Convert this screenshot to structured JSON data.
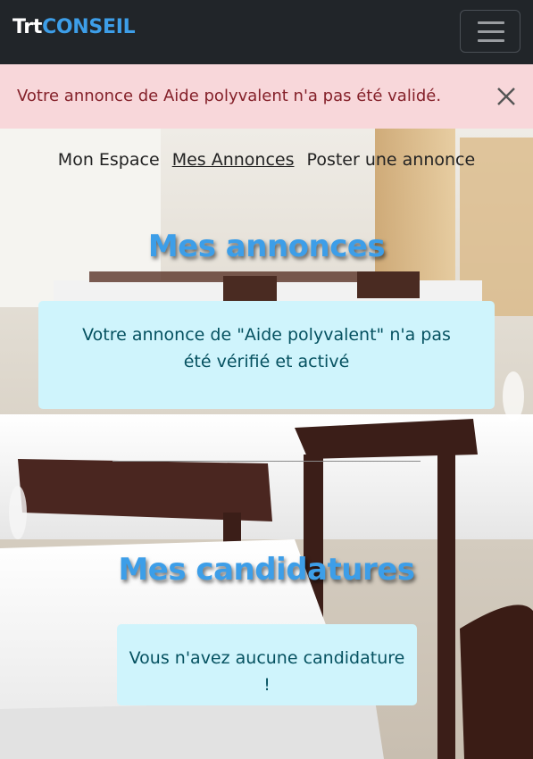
{
  "navbar": {
    "brand_part1": "Trt",
    "brand_part2": "CONSEIL",
    "toggler_icon": "hamburger-icon"
  },
  "alert": {
    "message": "Votre annonce de Aide polyvalent n'a pas été validé.",
    "close_icon": "close-icon"
  },
  "subnav": {
    "items": [
      {
        "label": "Mon Espace"
      },
      {
        "label": "Mes Annonces"
      },
      {
        "label": "Poster une annonce"
      }
    ]
  },
  "annonces": {
    "title": "Mes annonces",
    "message": "Votre annonce de \"Aide polyvalent\" n'a pas été vérifié et activé"
  },
  "candidatures": {
    "title": "Mes candidatures",
    "message": "Vous n'avez aucune candidature !"
  },
  "colors": {
    "navbar_bg": "#212529",
    "brand_accent": "#3d9ee8",
    "alert_bg": "#f8d7da",
    "alert_text": "#842029",
    "info_bg": "#cff4fc",
    "info_text": "#055160"
  }
}
